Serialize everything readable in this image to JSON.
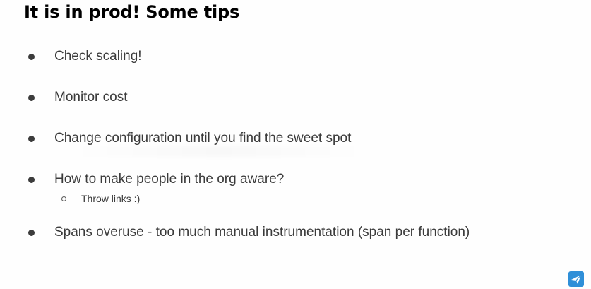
{
  "slide": {
    "title": "It is in prod! Some tips",
    "bullets": [
      "Check scaling!",
      "Monitor cost",
      "Change configuration until you find the sweet spot",
      "How to make people in the org aware?",
      "Spans overuse - too much manual instrumentation (span per function)"
    ],
    "sub_bullets": [
      "Throw links :)"
    ]
  },
  "colors": {
    "background": "#fefefe",
    "title": "#000000",
    "text": "#3a3a3a",
    "logo": "#2f8fd8"
  },
  "icons": {
    "corner_logo": "paper-plane-logo-icon"
  }
}
